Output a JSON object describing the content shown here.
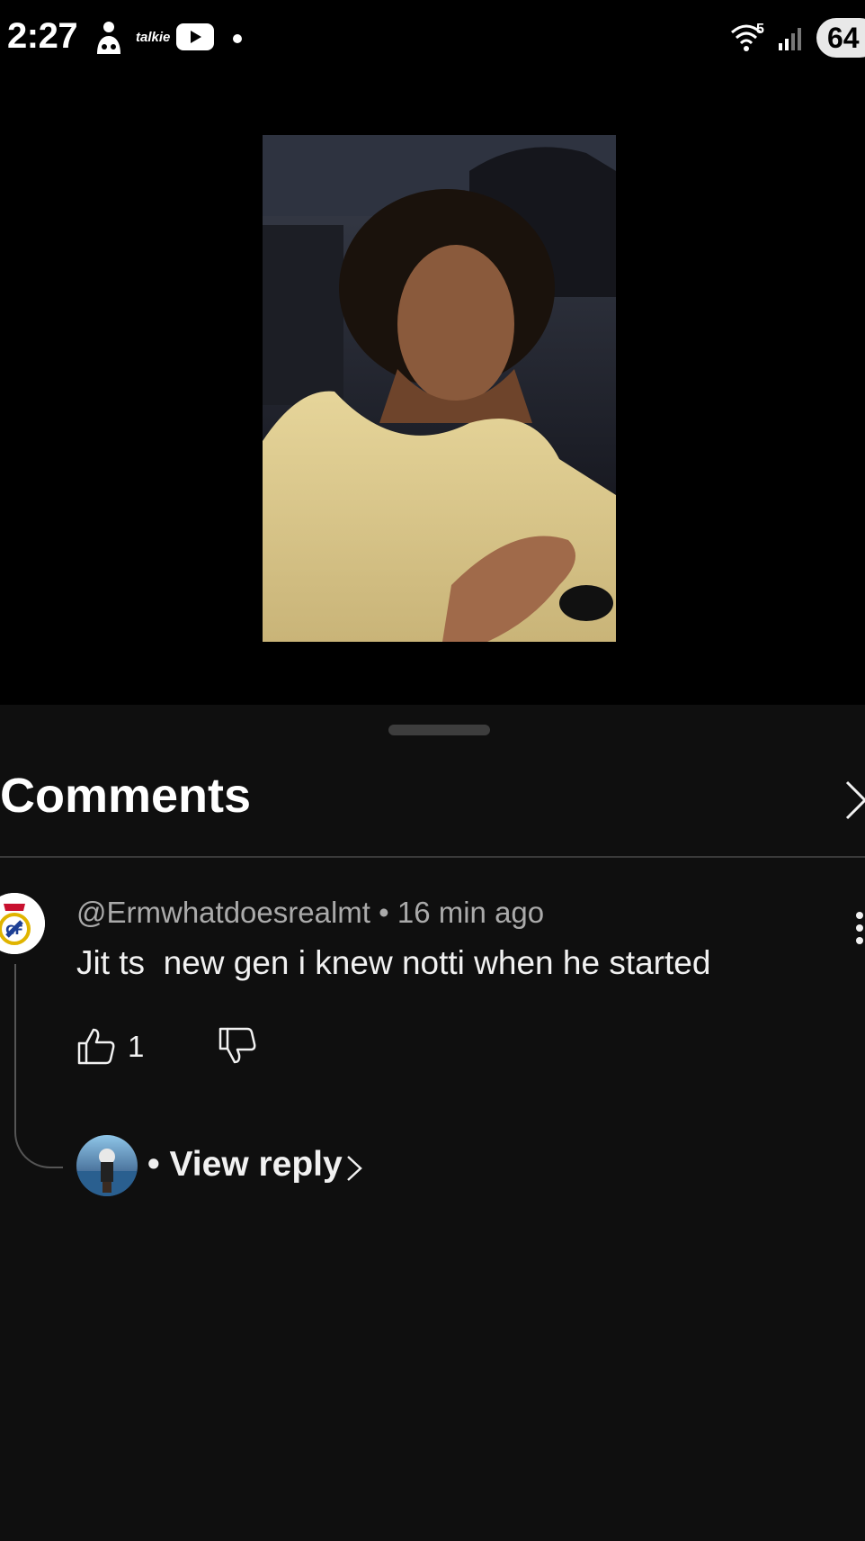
{
  "status_bar": {
    "time": "2:27",
    "app_label": "talkie",
    "wifi_label": "5",
    "battery": "64",
    "icons": [
      "assistant-icon",
      "talkie-icon",
      "youtube-icon",
      "notification-dot-icon",
      "wifi-icon",
      "signal-icon",
      "battery-icon"
    ]
  },
  "sheet": {
    "title": "Comments"
  },
  "comment": {
    "author": "@Ermwhatdoesrealmt",
    "separator": "•",
    "time_ago": "16 min ago",
    "text": "Jit ts  new gen i knew notti when he started",
    "like_count": "1"
  },
  "reply": {
    "label": "• View reply"
  },
  "colors": {
    "background": "#000000",
    "sheet_background": "#0f0f0f",
    "primary_text": "#f1f1f1",
    "secondary_text": "#aaaaaa",
    "divider": "#3a3a3a"
  }
}
